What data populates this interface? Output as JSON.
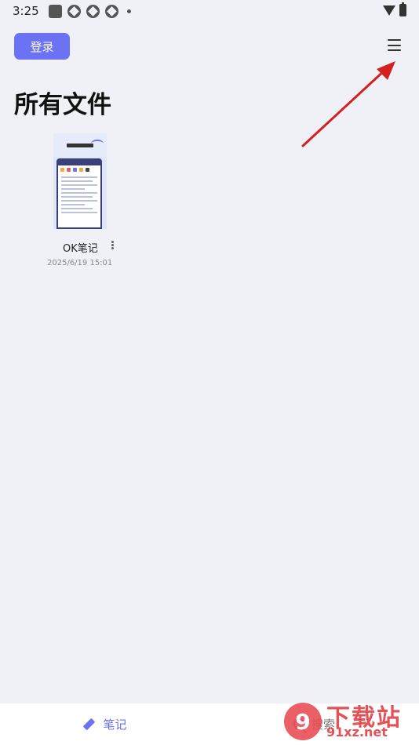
{
  "status_bar": {
    "time": "3:25",
    "icons": [
      "app-square-icon",
      "shield-icon",
      "shield-icon",
      "shield-icon",
      "notification-dot-icon",
      "wifi-icon",
      "battery-icon"
    ]
  },
  "header": {
    "login_label": "登录",
    "menu_icon": "hamburger-menu-icon"
  },
  "page": {
    "title": "所有文件"
  },
  "files": [
    {
      "name": "OK笔记",
      "date": "2025/6/19 15:01"
    }
  ],
  "bottom_nav": {
    "notes_label": "笔记",
    "search_label": "搜索"
  },
  "annotation": {
    "arrow_color": "#d62020"
  },
  "watermark": {
    "logo_text": "9",
    "big_text": "下载站",
    "small_text": "91xz.net"
  },
  "colors": {
    "accent": "#6b72f3",
    "background": "#f0f1f7"
  }
}
